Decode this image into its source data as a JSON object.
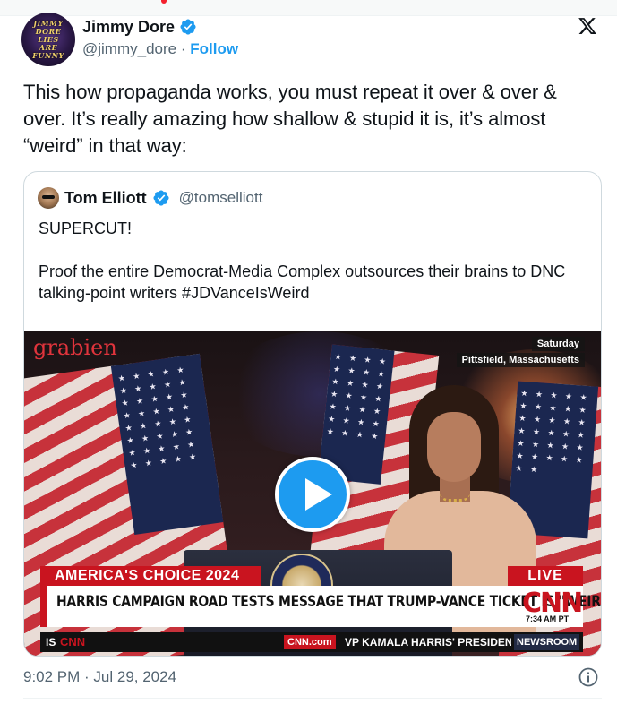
{
  "author": {
    "name": "Jimmy Dore",
    "handle": "@jimmy_dore",
    "separator": " · ",
    "follow_label": "Follow",
    "avatar_text": [
      "JIMMY",
      "DORE",
      "LIES",
      "ARE",
      "FUNNY"
    ],
    "verified": true
  },
  "tweet": {
    "text": "This how propaganda works, you must repeat it over & over & over. It’s really amazing how shallow & stupid it is, it’s almost “weird” in that way:",
    "timestamp": "9:02 PM · Jul 29, 2024"
  },
  "quote": {
    "name": "Tom Elliott",
    "handle": "@tomselliott",
    "verified": true,
    "line1": "SUPERCUT!",
    "line2": "Proof the entire Democrat-Media Complex outsources their brains to DNC talking-point writers #JDVanceIsWeird"
  },
  "video": {
    "watermark": "grabien",
    "day": "Saturday",
    "location": "Pittsfield, Massachusetts",
    "seal_text": "PRESIDENT OF THE UNITED STATES",
    "chyron_top": "AMERICA'S CHOICE 2024",
    "live": "LIVE",
    "headline": "HARRIS CAMPAIGN ROAD TESTS MESSAGE THAT TRUMP-VANCE TICKET IS \"WEIRD\"",
    "network": "CNN",
    "time": "7:34 AM PT",
    "ticker_left": "IS",
    "ticker_cnn": "CNN",
    "ticker_site": "CNN.com",
    "ticker_text": "VP KAMALA HARRIS' PRESIDEN",
    "ticker_show": "NEWSROOM"
  },
  "colors": {
    "link_blue": "#1d9bf0",
    "text_primary": "#0f1419",
    "text_secondary": "#536471",
    "cnn_red": "#c9141f"
  },
  "icons": {
    "verified": "verified-badge-icon",
    "x_logo": "x-logo-icon",
    "play": "play-icon",
    "info": "info-icon"
  }
}
